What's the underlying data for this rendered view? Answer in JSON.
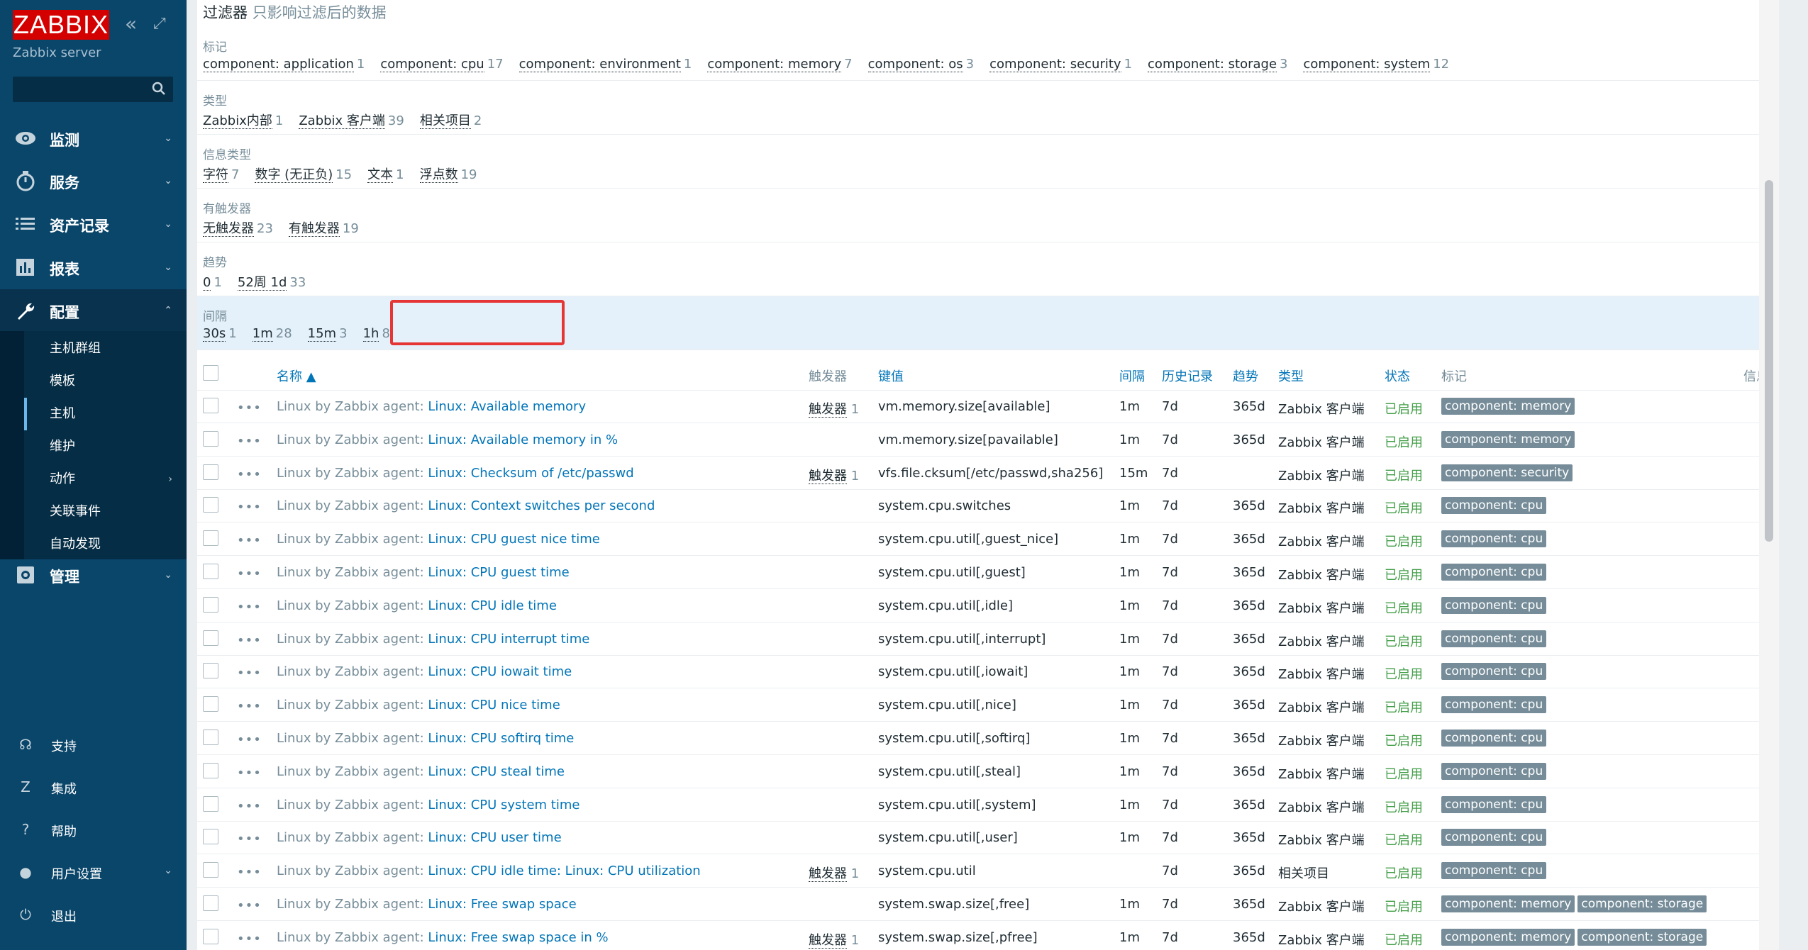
{
  "sidebar": {
    "logo": "ZABBIX",
    "server": "Zabbix server",
    "search_placeholder": "",
    "nav": [
      {
        "label": "监测",
        "icon": "eye-icon"
      },
      {
        "label": "服务",
        "icon": "clock-icon"
      },
      {
        "label": "资产记录",
        "icon": "list-icon"
      },
      {
        "label": "报表",
        "icon": "chart-icon"
      },
      {
        "label": "配置",
        "icon": "wrench-icon"
      }
    ],
    "config_items": [
      {
        "label": "主机群组"
      },
      {
        "label": "模板"
      },
      {
        "label": "主机"
      },
      {
        "label": "维护"
      },
      {
        "label": "动作"
      },
      {
        "label": "关联事件"
      },
      {
        "label": "自动发现"
      }
    ],
    "admin": {
      "label": "管理",
      "icon": "gear-icon"
    },
    "bottom": [
      {
        "label": "支持",
        "icon": "headset-icon"
      },
      {
        "label": "集成",
        "icon": "z-icon"
      },
      {
        "label": "帮助",
        "icon": "question-icon"
      },
      {
        "label": "用户设置",
        "icon": "user-icon"
      },
      {
        "label": "退出",
        "icon": "power-icon"
      }
    ]
  },
  "filter": {
    "title": "过滤器",
    "subtitle": "只影响过滤后的数据",
    "sections": [
      {
        "title": "标记",
        "items": [
          [
            "component: application",
            "1"
          ],
          [
            "component: cpu",
            "17"
          ],
          [
            "component: environment",
            "1"
          ],
          [
            "component: memory",
            "7"
          ],
          [
            "component: os",
            "3"
          ],
          [
            "component: security",
            "1"
          ],
          [
            "component: storage",
            "3"
          ],
          [
            "component: system",
            "12"
          ]
        ]
      },
      {
        "title": "类型",
        "items": [
          [
            "Zabbix内部",
            "1"
          ],
          [
            "Zabbix 客户端",
            "39"
          ],
          [
            "相关项目",
            "2"
          ]
        ]
      },
      {
        "title": "信息类型",
        "items": [
          [
            "字符",
            "7"
          ],
          [
            "数字 (无正负)",
            "15"
          ],
          [
            "文本",
            "1"
          ],
          [
            "浮点数",
            "19"
          ]
        ]
      },
      {
        "title": "有触发器",
        "items": [
          [
            "无触发器",
            "23"
          ],
          [
            "有触发器",
            "19"
          ]
        ]
      },
      {
        "title": "趋势",
        "items": [
          [
            "0",
            "1"
          ],
          [
            "52周 1d",
            "33"
          ]
        ]
      },
      {
        "title": "间隔",
        "items": [
          [
            "30s",
            "1"
          ],
          [
            "1m",
            "28"
          ],
          [
            "15m",
            "3"
          ],
          [
            "1h",
            "8"
          ]
        ]
      }
    ]
  },
  "table": {
    "headers": {
      "name": "名称 ▲",
      "triggers": "触发器",
      "key": "键值",
      "interval": "间隔",
      "history": "历史记录",
      "trends": "趋势",
      "type": "类型",
      "status": "状态",
      "tags": "标记",
      "info": "信息"
    },
    "rows": [
      {
        "host": "Linux by Zabbix agent",
        "name": "Linux: Available memory",
        "trig": "触发器",
        "trigc": "1",
        "key": "vm.memory.size[available]",
        "iv": "1m",
        "hist": "7d",
        "tr": "365d",
        "type": "Zabbix 客户端",
        "status": "已启用",
        "tags": [
          "component: memory"
        ]
      },
      {
        "host": "Linux by Zabbix agent",
        "name": "Linux: Available memory in %",
        "trig": "",
        "trigc": "",
        "key": "vm.memory.size[pavailable]",
        "iv": "1m",
        "hist": "7d",
        "tr": "365d",
        "type": "Zabbix 客户端",
        "status": "已启用",
        "tags": [
          "component: memory"
        ]
      },
      {
        "host": "Linux by Zabbix agent",
        "name": "Linux: Checksum of /etc/passwd",
        "trig": "触发器",
        "trigc": "1",
        "key": "vfs.file.cksum[/etc/passwd,sha256]",
        "iv": "15m",
        "hist": "7d",
        "tr": "",
        "type": "Zabbix 客户端",
        "status": "已启用",
        "tags": [
          "component: security"
        ]
      },
      {
        "host": "Linux by Zabbix agent",
        "name": "Linux: Context switches per second",
        "trig": "",
        "trigc": "",
        "key": "system.cpu.switches",
        "iv": "1m",
        "hist": "7d",
        "tr": "365d",
        "type": "Zabbix 客户端",
        "status": "已启用",
        "tags": [
          "component: cpu"
        ]
      },
      {
        "host": "Linux by Zabbix agent",
        "name": "Linux: CPU guest nice time",
        "trig": "",
        "trigc": "",
        "key": "system.cpu.util[,guest_nice]",
        "iv": "1m",
        "hist": "7d",
        "tr": "365d",
        "type": "Zabbix 客户端",
        "status": "已启用",
        "tags": [
          "component: cpu"
        ]
      },
      {
        "host": "Linux by Zabbix agent",
        "name": "Linux: CPU guest time",
        "trig": "",
        "trigc": "",
        "key": "system.cpu.util[,guest]",
        "iv": "1m",
        "hist": "7d",
        "tr": "365d",
        "type": "Zabbix 客户端",
        "status": "已启用",
        "tags": [
          "component: cpu"
        ]
      },
      {
        "host": "Linux by Zabbix agent",
        "name": "Linux: CPU idle time",
        "trig": "",
        "trigc": "",
        "key": "system.cpu.util[,idle]",
        "iv": "1m",
        "hist": "7d",
        "tr": "365d",
        "type": "Zabbix 客户端",
        "status": "已启用",
        "tags": [
          "component: cpu"
        ]
      },
      {
        "host": "Linux by Zabbix agent",
        "name": "Linux: CPU interrupt time",
        "trig": "",
        "trigc": "",
        "key": "system.cpu.util[,interrupt]",
        "iv": "1m",
        "hist": "7d",
        "tr": "365d",
        "type": "Zabbix 客户端",
        "status": "已启用",
        "tags": [
          "component: cpu"
        ]
      },
      {
        "host": "Linux by Zabbix agent",
        "name": "Linux: CPU iowait time",
        "trig": "",
        "trigc": "",
        "key": "system.cpu.util[,iowait]",
        "iv": "1m",
        "hist": "7d",
        "tr": "365d",
        "type": "Zabbix 客户端",
        "status": "已启用",
        "tags": [
          "component: cpu"
        ]
      },
      {
        "host": "Linux by Zabbix agent",
        "name": "Linux: CPU nice time",
        "trig": "",
        "trigc": "",
        "key": "system.cpu.util[,nice]",
        "iv": "1m",
        "hist": "7d",
        "tr": "365d",
        "type": "Zabbix 客户端",
        "status": "已启用",
        "tags": [
          "component: cpu"
        ]
      },
      {
        "host": "Linux by Zabbix agent",
        "name": "Linux: CPU softirq time",
        "trig": "",
        "trigc": "",
        "key": "system.cpu.util[,softirq]",
        "iv": "1m",
        "hist": "7d",
        "tr": "365d",
        "type": "Zabbix 客户端",
        "status": "已启用",
        "tags": [
          "component: cpu"
        ]
      },
      {
        "host": "Linux by Zabbix agent",
        "name": "Linux: CPU steal time",
        "trig": "",
        "trigc": "",
        "key": "system.cpu.util[,steal]",
        "iv": "1m",
        "hist": "7d",
        "tr": "365d",
        "type": "Zabbix 客户端",
        "status": "已启用",
        "tags": [
          "component: cpu"
        ]
      },
      {
        "host": "Linux by Zabbix agent",
        "name": "Linux: CPU system time",
        "trig": "",
        "trigc": "",
        "key": "system.cpu.util[,system]",
        "iv": "1m",
        "hist": "7d",
        "tr": "365d",
        "type": "Zabbix 客户端",
        "status": "已启用",
        "tags": [
          "component: cpu"
        ]
      },
      {
        "host": "Linux by Zabbix agent",
        "name": "Linux: CPU user time",
        "trig": "",
        "trigc": "",
        "key": "system.cpu.util[,user]",
        "iv": "1m",
        "hist": "7d",
        "tr": "365d",
        "type": "Zabbix 客户端",
        "status": "已启用",
        "tags": [
          "component: cpu"
        ]
      },
      {
        "host": "Linux by Zabbix agent",
        "name": "Linux: CPU idle time: Linux: CPU utilization",
        "trig": "触发器",
        "trigc": "1",
        "key": "system.cpu.util",
        "iv": "",
        "hist": "7d",
        "tr": "365d",
        "type": "相关项目",
        "status": "已启用",
        "tags": [
          "component: cpu"
        ]
      },
      {
        "host": "Linux by Zabbix agent",
        "name": "Linux: Free swap space",
        "trig": "",
        "trigc": "",
        "key": "system.swap.size[,free]",
        "iv": "1m",
        "hist": "7d",
        "tr": "365d",
        "type": "Zabbix 客户端",
        "status": "已启用",
        "tags": [
          "component: memory",
          "component: storage"
        ]
      },
      {
        "host": "Linux by Zabbix agent",
        "name": "Linux: Free swap space in %",
        "trig": "触发器",
        "trigc": "1",
        "key": "system.swap.size[,pfree]",
        "iv": "1m",
        "hist": "7d",
        "tr": "365d",
        "type": "Zabbix 客户端",
        "status": "已启用",
        "tags": [
          "component: memory",
          "component: storage"
        ]
      }
    ]
  }
}
